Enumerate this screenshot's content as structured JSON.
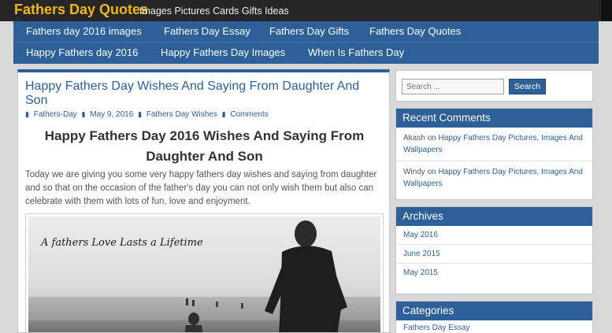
{
  "header": {
    "logo": "Fathers Day Quotes",
    "tagline": "Images Pictures Cards Gifts Ideas"
  },
  "nav": {
    "row1": [
      "Fathers day 2016 images",
      "Fathers Day Essay",
      "Fathers Day Gifts",
      "Fathers Day Quotes"
    ],
    "row2": [
      "Happy Fathers day 2016",
      "Happy Fathers Day Images",
      "When Is Fathers Day"
    ]
  },
  "post": {
    "title": "Happy Fathers Day Wishes And Saying From Daughter And Son",
    "meta": {
      "author": "Fathers-Day",
      "date": "May 9, 2016",
      "category": "Fathers Day Wishes",
      "comments": "Comments"
    },
    "headline": "Happy Fathers Day 2016 Wishes And Saying From Daughter And Son",
    "body": "Today we are giving you some very happy fathers day wishes and saying from daughter and so that on the occasion of the father's day you can not only wish them but also can celebrate with them with lots of fun, love and enjoyment.",
    "image_caption": "A fathers Love Lasts a Lifetime"
  },
  "search": {
    "placeholder": "Search ...",
    "button_label": "Search"
  },
  "recent_comments": {
    "title": "Recent Comments",
    "items": [
      {
        "author": "Akash",
        "on": "on",
        "post": "Happy Fathers Day Pictures, Images And Wallpapers"
      },
      {
        "author": "Windy",
        "on": "on",
        "post": "Happy Fathers Day Pictures, Images And Wallpapers"
      }
    ]
  },
  "archives": {
    "title": "Archives",
    "items": [
      "May 2016",
      "June 2015",
      "May 2015"
    ]
  },
  "categories": {
    "title": "Categories",
    "items": [
      "Fathers Day Essay"
    ]
  },
  "colors": {
    "accent": "#2d5f98",
    "logo": "#f2b61a",
    "topbar": "#262626"
  },
  "icons": {
    "author": "folder-icon",
    "date": "calendar-icon",
    "category": "tag-icon",
    "comments": "comment-icon"
  }
}
